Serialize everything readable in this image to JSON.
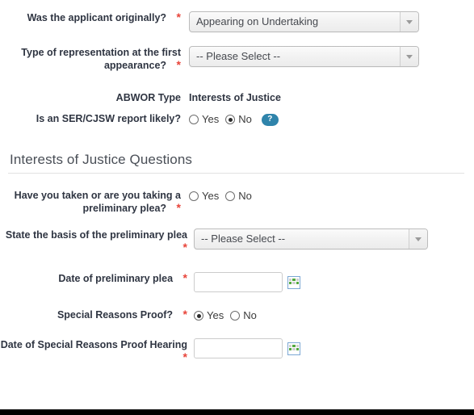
{
  "theme": {
    "accent_badge": "#2f84ab",
    "required_star": "#e8443a",
    "label_text": "#2f3542",
    "heading_text": "#4a4f57",
    "divider": "#e2e2e2",
    "page_bg": "#ffffff",
    "bottom_bar": "#000000"
  },
  "rows": {
    "applicant_originally": {
      "label": "Was the applicant originally?",
      "required_star": "*",
      "value": "Appearing on Undertaking",
      "icon": "chevron-down-icon"
    },
    "representation_type": {
      "label": "Type of representation at the first appearance?",
      "required_star": "*",
      "value": "-- Please Select --",
      "icon": "chevron-down-icon"
    },
    "abwor": {
      "label": "ABWOR Type",
      "value": "Interests of Justice"
    },
    "ser_report": {
      "label": "Is an SER/CJSW report likely?",
      "options": [
        {
          "label": "Yes",
          "selected": false
        },
        {
          "label": "No",
          "selected": true
        }
      ],
      "help_label": "?",
      "help_icon": "question-mark-icon"
    }
  },
  "section": {
    "heading": "Interests of Justice Questions",
    "rows": {
      "preliminary_plea_taken": {
        "label": "Have you taken or are you taking a preliminary plea?",
        "required_star": "*",
        "options": [
          {
            "label": "Yes",
            "selected": false
          },
          {
            "label": "No",
            "selected": false
          }
        ]
      },
      "plea_basis": {
        "label": "State the basis of the preliminary plea",
        "required_star": "*",
        "value": "-- Please Select --",
        "icon": "chevron-down-icon"
      },
      "plea_date": {
        "label": "Date of preliminary plea",
        "required_star": "*",
        "value": "",
        "placeholder": "",
        "icon": "calendar-icon"
      },
      "special_reasons_proof": {
        "label": "Special Reasons Proof?",
        "required_star": "*",
        "options": [
          {
            "label": "Yes",
            "selected": true
          },
          {
            "label": "No",
            "selected": false
          }
        ]
      },
      "special_reasons_date": {
        "label": "Date of Special Reasons Proof Hearing",
        "required_star": "*",
        "value": "",
        "placeholder": "",
        "icon": "calendar-icon"
      }
    }
  }
}
